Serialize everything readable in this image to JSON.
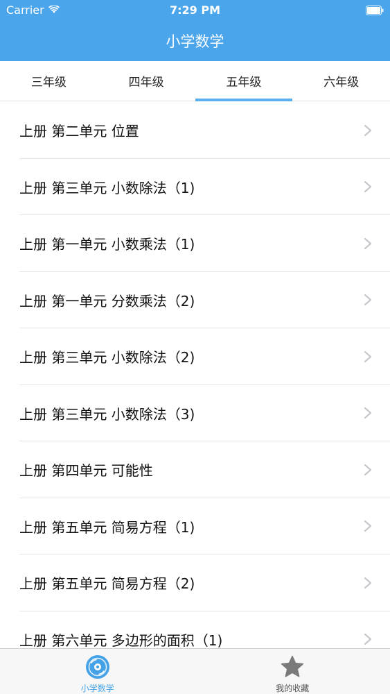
{
  "status_bar": {
    "carrier": "Carrier",
    "time": "7:29 PM"
  },
  "nav": {
    "title": "小学数学"
  },
  "grade_tabs": [
    {
      "label": "三年级",
      "active": false
    },
    {
      "label": "四年级",
      "active": false
    },
    {
      "label": "五年级",
      "active": true
    },
    {
      "label": "六年级",
      "active": false
    }
  ],
  "lessons": [
    "上册 第二单元 位置",
    "上册 第三单元 小数除法（1)",
    "上册 第一单元 小数乘法（1)",
    "上册 第一单元 分数乘法（2)",
    "上册 第三单元 小数除法（2)",
    "上册 第三单元 小数除法（3)",
    "上册 第四单元 可能性",
    "上册 第五单元 简易方程（1)",
    "上册 第五单元 简易方程（2)",
    "上册 第六单元 多边形的面积（1)"
  ],
  "tabbar": {
    "items": [
      {
        "label": "小学数学",
        "icon": "disc-icon",
        "active": true
      },
      {
        "label": "我的收藏",
        "icon": "star-icon",
        "active": false
      }
    ]
  },
  "colors": {
    "header": "#4aa5ea",
    "accent": "#58aeee",
    "tabbar_active": "#45a2e6",
    "star": "#7a7a7a"
  }
}
